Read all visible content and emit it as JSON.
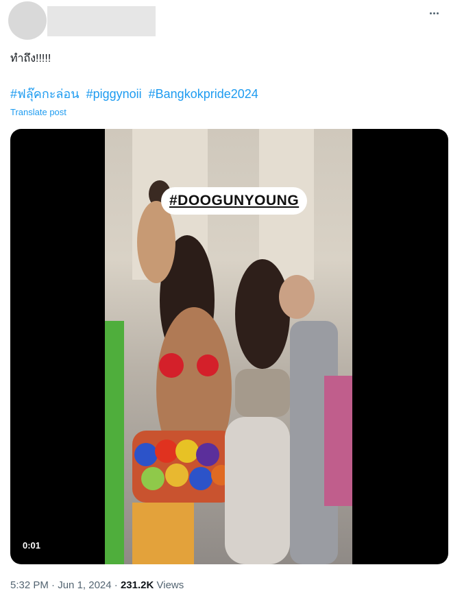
{
  "post": {
    "text": "ทำถึง!!!!!",
    "hashtags": [
      "#ฟลุ๊คกะล่อน",
      "#piggynoii",
      "#Bangkokpride2024"
    ],
    "translate_label": "Translate post"
  },
  "media": {
    "overlay_caption": "#DOOGUNYOUNG",
    "timecode": "0:01"
  },
  "footer": {
    "time": "5:32 PM",
    "date": "Jun 1, 2024",
    "views_count": "231.2K",
    "views_label": "Views",
    "separator": "·"
  },
  "icons": {
    "more": "more-options-icon"
  }
}
